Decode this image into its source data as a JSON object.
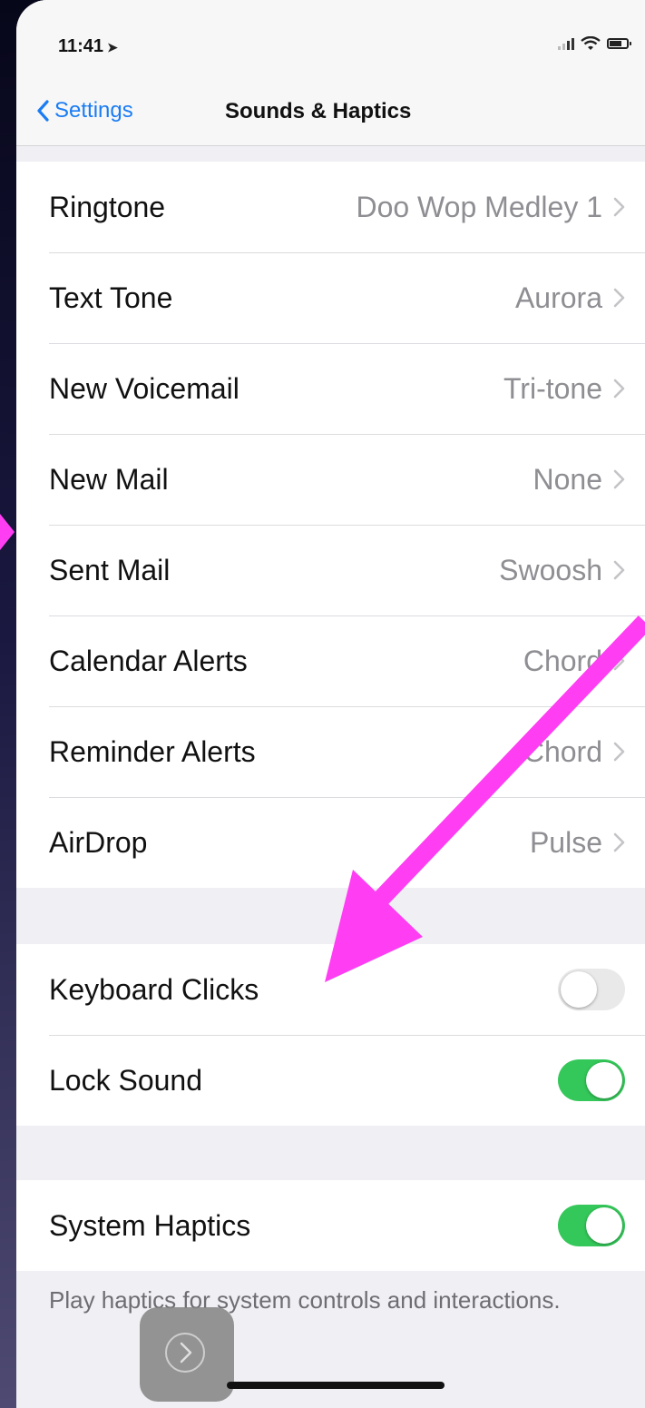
{
  "status_bar": {
    "time": "11:41",
    "location_glyph": "➤"
  },
  "nav": {
    "back_label": "Settings",
    "title": "Sounds & Haptics"
  },
  "sounds": [
    {
      "label": "Ringtone",
      "value": "Doo Wop Medley 1"
    },
    {
      "label": "Text Tone",
      "value": "Aurora"
    },
    {
      "label": "New Voicemail",
      "value": "Tri-tone"
    },
    {
      "label": "New Mail",
      "value": "None"
    },
    {
      "label": "Sent Mail",
      "value": "Swoosh"
    },
    {
      "label": "Calendar Alerts",
      "value": "Chord"
    },
    {
      "label": "Reminder Alerts",
      "value": "Chord"
    },
    {
      "label": "AirDrop",
      "value": "Pulse"
    }
  ],
  "toggles": [
    {
      "label": "Keyboard Clicks",
      "on": false
    },
    {
      "label": "Lock Sound",
      "on": true
    }
  ],
  "haptics": {
    "label": "System Haptics",
    "on": true
  },
  "footer_note": "Play haptics for system controls and interactions.",
  "colors": {
    "accent": "#1a7cf4",
    "toggle_on": "#34c759",
    "annotation": "#ff3df2"
  }
}
